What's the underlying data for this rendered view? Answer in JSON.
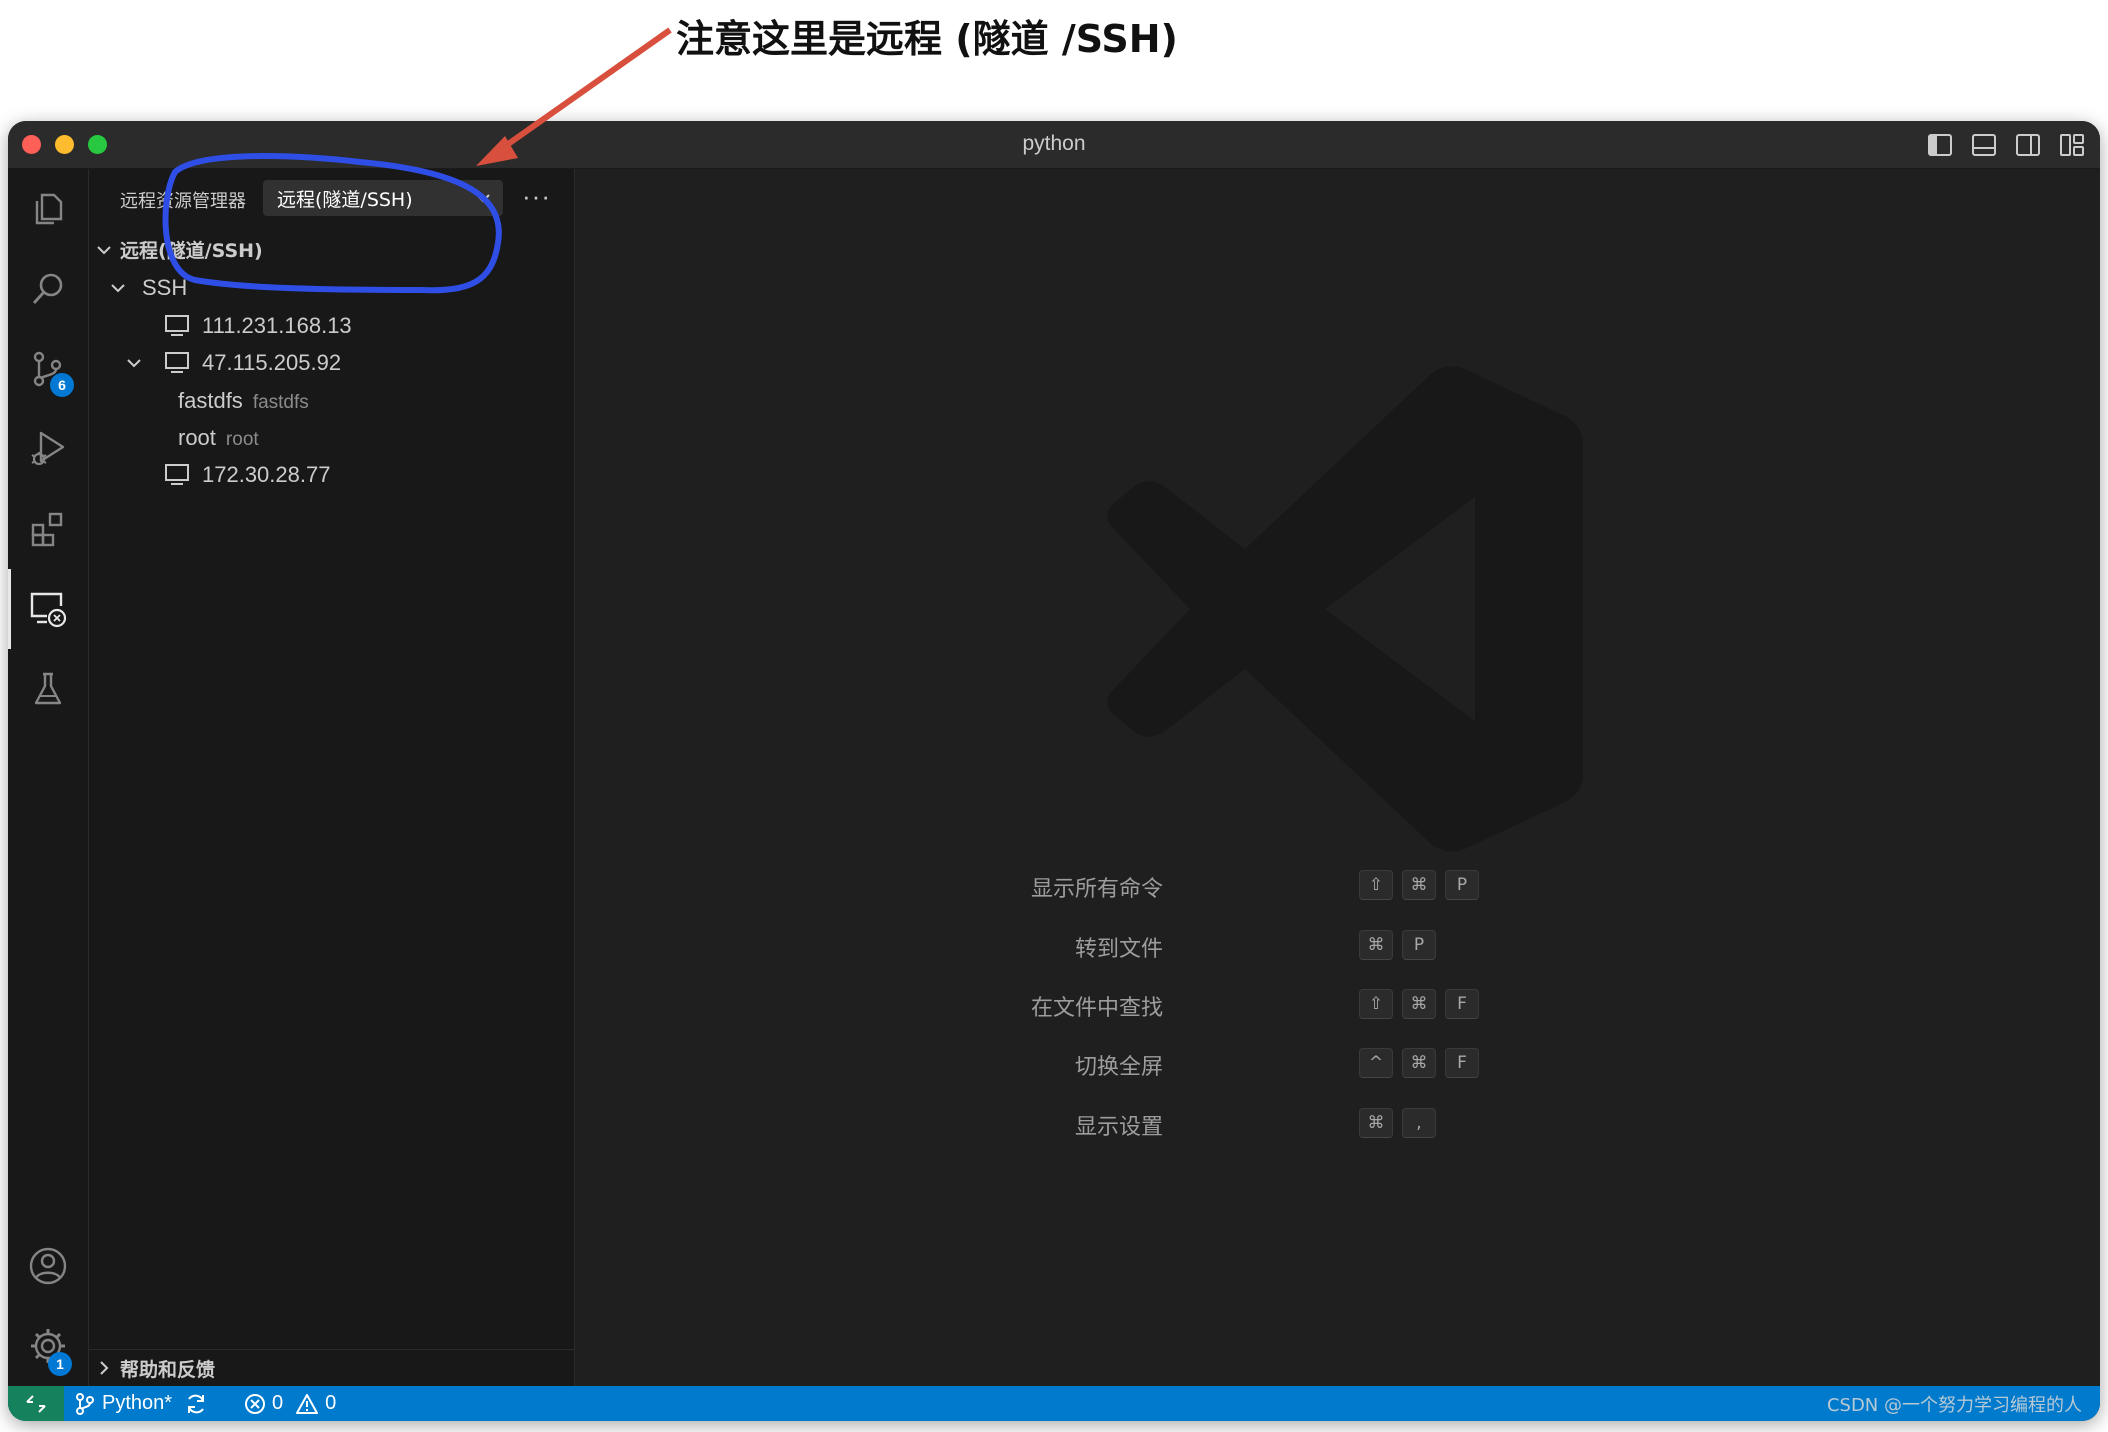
{
  "annotation": {
    "text": "注意这里是远程 (隧道 /SSH)",
    "arrow_color": "#d94f3d",
    "circle_color": "#2e4ee6"
  },
  "window": {
    "title": "python"
  },
  "activity_bar": {
    "items": [
      {
        "name": "explorer-icon"
      },
      {
        "name": "search-icon"
      },
      {
        "name": "source-control-icon",
        "badge": "6"
      },
      {
        "name": "run-debug-icon"
      },
      {
        "name": "extensions-icon"
      },
      {
        "name": "remote-explorer-icon",
        "active": true
      },
      {
        "name": "testing-icon"
      }
    ],
    "bottom": [
      {
        "name": "accounts-icon"
      },
      {
        "name": "manage-gear-icon",
        "badge": "1"
      }
    ]
  },
  "sidebar": {
    "title": "远程资源管理器",
    "selector_value": "远程(隧道/SSH)",
    "more_label": "···",
    "section_title": "远程(隧道/SSH)",
    "group_label": "SSH",
    "hosts": [
      {
        "label": "111.231.168.13",
        "expanded": false
      },
      {
        "label": "47.115.205.92",
        "expanded": true,
        "children": [
          {
            "label": "fastdfs",
            "description": "fastdfs"
          },
          {
            "label": "root",
            "description": "root"
          }
        ]
      },
      {
        "label": "172.30.28.77",
        "expanded": false
      }
    ],
    "help_section": "帮助和反馈"
  },
  "editor": {
    "shortcuts": [
      {
        "label": "显示所有命令",
        "keys": [
          "⇧",
          "⌘",
          "P"
        ]
      },
      {
        "label": "转到文件",
        "keys": [
          "⌘",
          "P"
        ]
      },
      {
        "label": "在文件中查找",
        "keys": [
          "⇧",
          "⌘",
          "F"
        ]
      },
      {
        "label": "切换全屏",
        "keys": [
          "^",
          "⌘",
          "F"
        ]
      },
      {
        "label": "显示设置",
        "keys": [
          "⌘",
          ","
        ]
      }
    ]
  },
  "status_bar": {
    "branch": "Python*",
    "errors": "0",
    "warnings": "0",
    "watermark": "CSDN @一个努力学习编程的人"
  },
  "colors": {
    "status_bar": "#007acc",
    "remote_button": "#16825d",
    "badge": "#0078d4"
  }
}
